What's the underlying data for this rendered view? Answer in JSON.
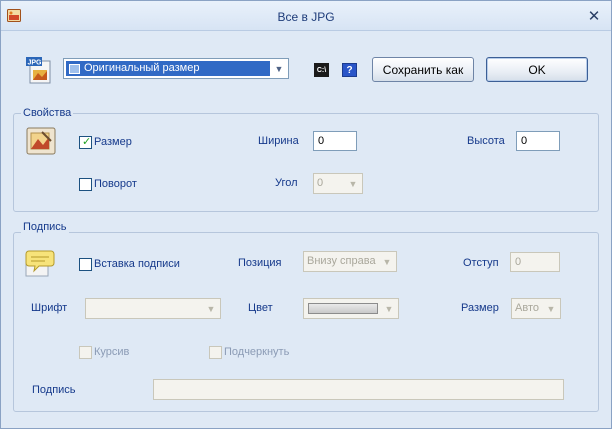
{
  "window": {
    "title": "Все в JPG",
    "close_glyph": "✕"
  },
  "top": {
    "size_combo_value": "Оригинальный размер",
    "cmd_icon_text": "C:\\",
    "help_icon_text": "?",
    "save_as_label": "Сохранить как",
    "ok_label": "OK",
    "jpg_badge": "JPG"
  },
  "properties": {
    "group_title": "Свойства",
    "size_checkbox_label": "Размер",
    "size_checked": true,
    "width_label": "Ширина",
    "width_value": "0",
    "height_label": "Высота",
    "height_value": "0",
    "rotate_checkbox_label": "Поворот",
    "rotate_checked": false,
    "angle_label": "Угол",
    "angle_value": "0"
  },
  "caption": {
    "group_title": "Подпись",
    "insert_checkbox_label": "Вставка подписи",
    "insert_checked": false,
    "position_label": "Позиция",
    "position_value": "Внизу справа",
    "indent_label": "Отступ",
    "indent_value": "0",
    "font_label": "Шрифт",
    "font_value": "",
    "color_label": "Цвет",
    "size_label": "Размер",
    "size_value": "Авто",
    "italic_label": "Курсив",
    "underline_label": "Подчеркнуть",
    "caption_label": "Подпись",
    "caption_value": ""
  },
  "colors": {
    "accent": "#316ac5",
    "label_text": "#15398b",
    "background": "#dfe9f5"
  }
}
